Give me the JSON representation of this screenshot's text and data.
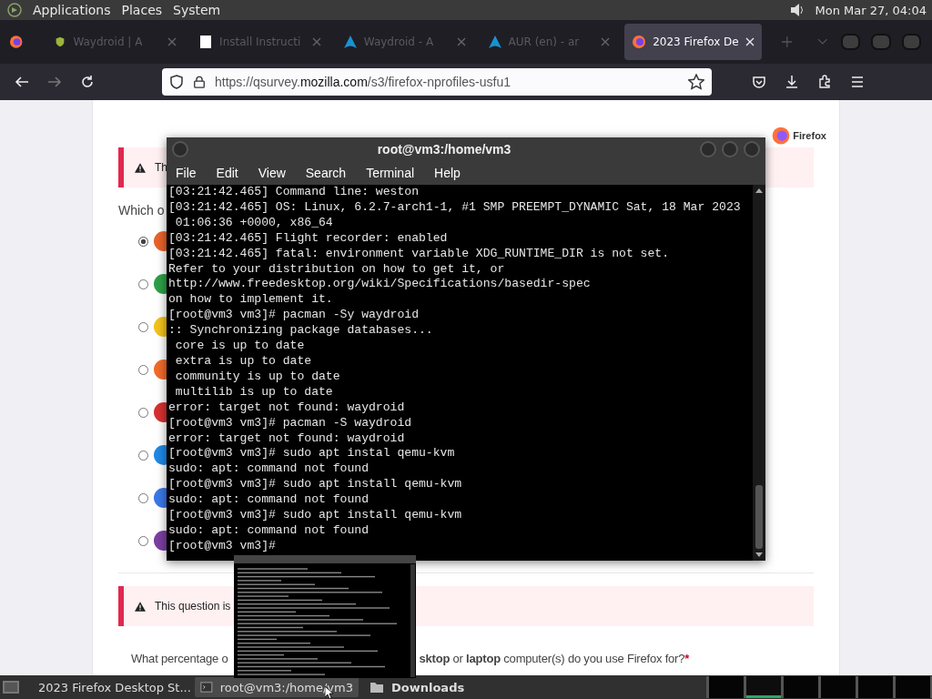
{
  "top_panel": {
    "menus": [
      "Applications",
      "Places",
      "System"
    ],
    "clock": "Mon Mar 27, 04:04"
  },
  "browser": {
    "tabs": [
      {
        "title": "Waydroid | A",
        "selected": false
      },
      {
        "title": "Install Instructi",
        "selected": false
      },
      {
        "title": "Waydroid - A",
        "selected": false
      },
      {
        "title": "AUR (en) - ar",
        "selected": false
      },
      {
        "title": "2023 Firefox De",
        "selected": true
      }
    ],
    "url_prefix": "https://qsurvey.",
    "url_domain": "mozilla.com",
    "url_path": "/s3/firefox-nprofiles-usfu1"
  },
  "survey": {
    "brand": "Firefox",
    "banner_1": "Th",
    "question_1": "Which o",
    "options": [
      {
        "selected": true,
        "color": "#e8632b"
      },
      {
        "selected": false,
        "color": "#2e9e48"
      },
      {
        "selected": false,
        "color": "#f2c21b"
      },
      {
        "selected": false,
        "color": "#f26a2a"
      },
      {
        "selected": false,
        "color": "#d63031"
      },
      {
        "selected": false,
        "color": "#1e88e5"
      },
      {
        "selected": false,
        "color": "#3b78e7"
      },
      {
        "selected": false,
        "color": "#7b3fa0"
      }
    ],
    "banner_2": "This question is",
    "question_2_start": "What percentage o",
    "question_2_end": "**sktop** or **laptop** computer(s) do you use Firefox for?",
    "required_mark": "*"
  },
  "terminal": {
    "title": "root@vm3:/home/vm3",
    "menus": [
      "File",
      "Edit",
      "View",
      "Search",
      "Terminal",
      "Help"
    ],
    "lines": [
      "[03:21:42.465] Command line: weston",
      "[03:21:42.465] OS: Linux, 6.2.7-arch1-1, #1 SMP PREEMPT_DYNAMIC Sat, 18 Mar 2023",
      " 01:06:36 +0000, x86_64",
      "[03:21:42.465] Flight recorder: enabled",
      "[03:21:42.465] fatal: environment variable XDG_RUNTIME_DIR is not set.",
      "Refer to your distribution on how to get it, or",
      "http://www.freedesktop.org/wiki/Specifications/basedir-spec",
      "on how to implement it.",
      "[root@vm3 vm3]# pacman -Sy waydroid",
      ":: Synchronizing package databases...",
      " core is up to date",
      " extra is up to date",
      " community is up to date",
      " multilib is up to date",
      "error: target not found: waydroid",
      "[root@vm3 vm3]# pacman -S waydroid",
      "error: target not found: waydroid",
      "[root@vm3 vm3]# sudo apt instal qemu-kvm",
      "sudo: apt: command not found",
      "[root@vm3 vm3]# sudo apt install qemu-kvm",
      "sudo: apt: command not found",
      "[root@vm3 vm3]# sudo apt install qemu-kvm",
      "sudo: apt: command not found",
      "[root@vm3 vm3]#"
    ]
  },
  "taskbar": {
    "tasks": [
      {
        "label": "2023 Firefox Desktop St...",
        "selected": false
      },
      {
        "label": "root@vm3:/home/vm3",
        "selected": true
      },
      {
        "label": "Downloads",
        "selected": false
      }
    ],
    "workspaces": [
      {
        "selected": false
      },
      {
        "selected": true
      },
      {
        "selected": false
      },
      {
        "selected": false
      },
      {
        "selected": false
      },
      {
        "selected": false
      }
    ]
  }
}
